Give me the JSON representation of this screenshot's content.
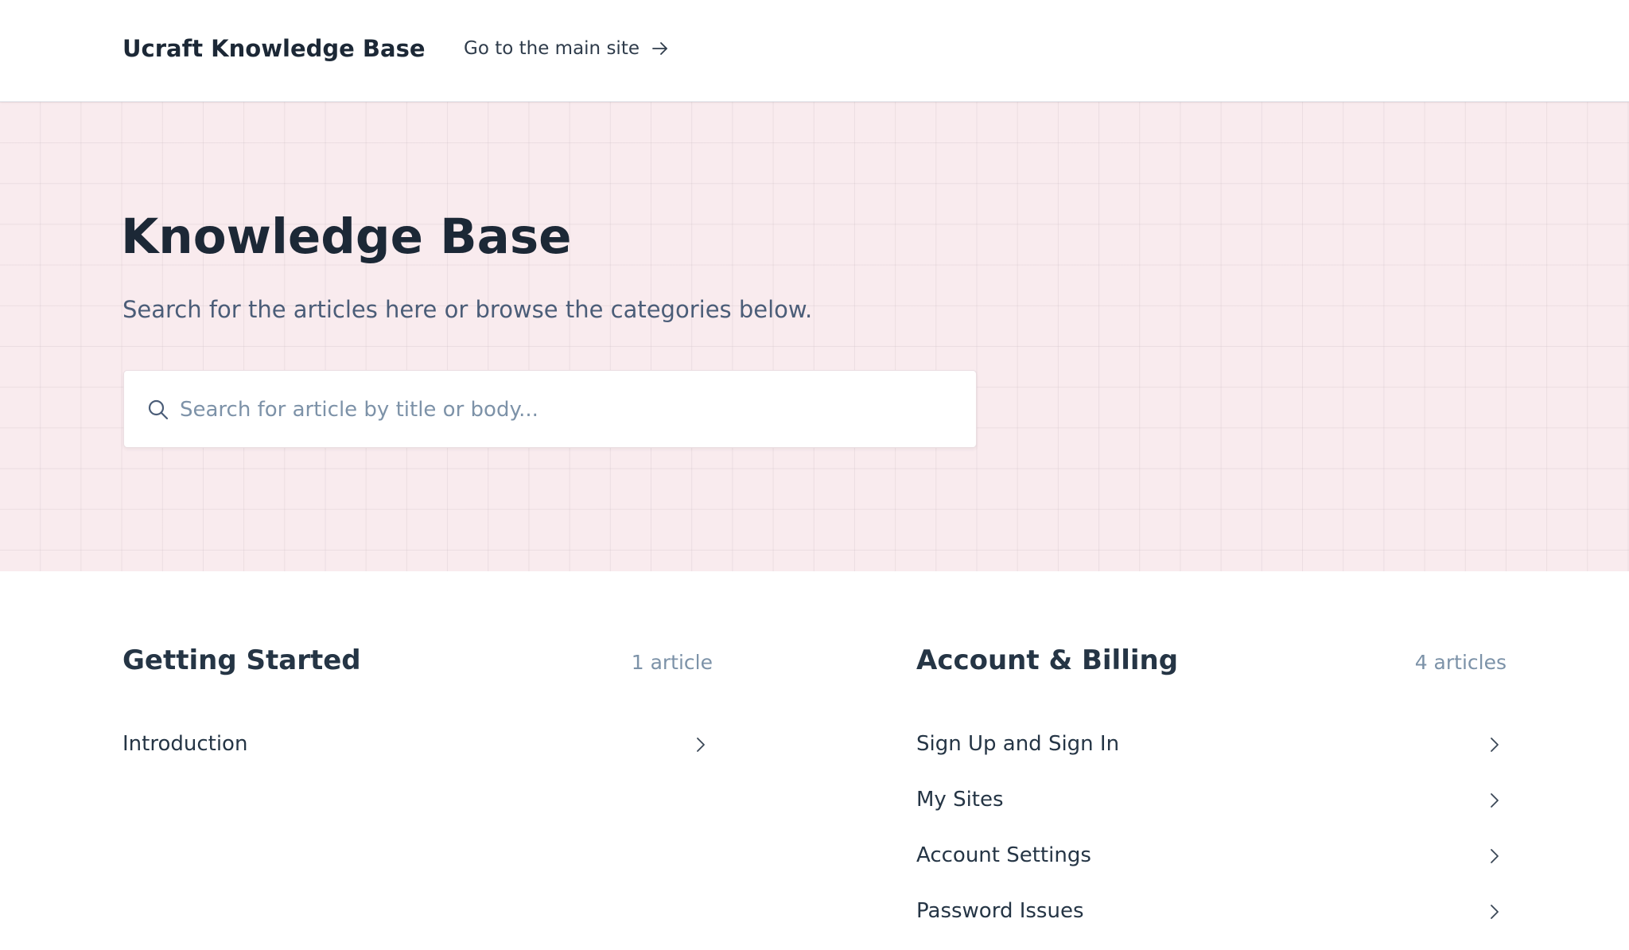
{
  "header": {
    "brand": "Ucraft Knowledge Base",
    "main_site_link": "Go to the main site",
    "arrow_icon": "arrow-right-icon"
  },
  "hero": {
    "title": "Knowledge Base",
    "subtitle": "Search for the articles here or browse the categories below.",
    "background_color": "#f9ebee",
    "search": {
      "placeholder": "Search for article by title or body...",
      "value": "",
      "icon": "search-icon"
    }
  },
  "categories": [
    {
      "title": "Getting Started",
      "count": "1 article",
      "articles": [
        {
          "title": "Introduction"
        }
      ]
    },
    {
      "title": "Account & Billing",
      "count": "4 articles",
      "articles": [
        {
          "title": "Sign Up and Sign In"
        },
        {
          "title": "My Sites"
        },
        {
          "title": "Account Settings"
        },
        {
          "title": "Password Issues"
        }
      ]
    }
  ],
  "colors": {
    "text_dark": "#1c2836",
    "text_muted": "#7c92a8",
    "hero_bg": "#f9ebee"
  }
}
